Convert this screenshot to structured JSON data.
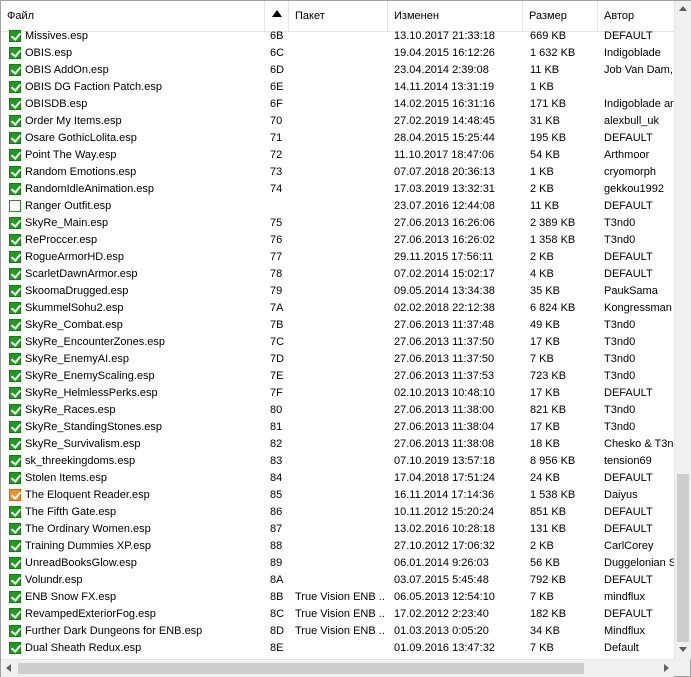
{
  "columns": {
    "file": "Файл",
    "index": "",
    "package": "Пакет",
    "modified": "Изменен",
    "size": "Размер",
    "author": "Автор"
  },
  "rows": [
    {
      "checkbox": "checked",
      "name": "Missives.esp",
      "index": "6B",
      "package": "",
      "modified": "13.10.2017 21:33:18",
      "size": "669 KB",
      "author": "DEFAULT"
    },
    {
      "checkbox": "checked",
      "name": "OBIS.esp",
      "index": "6C",
      "package": "",
      "modified": "19.04.2015 16:12:26",
      "size": "1 632 KB",
      "author": "Indigoblade"
    },
    {
      "checkbox": "checked",
      "name": "OBIS AddOn.esp",
      "index": "6D",
      "package": "",
      "modified": "23.04.2014 2:39:08",
      "size": "11 KB",
      "author": "Job Van Dam,"
    },
    {
      "checkbox": "checked",
      "name": "OBIS DG Faction Patch.esp",
      "index": "6E",
      "package": "",
      "modified": "14.11.2014 13:31:19",
      "size": "1 KB",
      "author": ""
    },
    {
      "checkbox": "checked",
      "name": "OBISDB.esp",
      "index": "6F",
      "package": "",
      "modified": "14.02.2015 16:31:16",
      "size": "171 KB",
      "author": "Indigoblade ar"
    },
    {
      "checkbox": "checked",
      "name": "Order My Items.esp",
      "index": "70",
      "package": "",
      "modified": "27.02.2019 14:48:45",
      "size": "31 KB",
      "author": "alexbull_uk"
    },
    {
      "checkbox": "checked",
      "name": "Osare GothicLolita.esp",
      "index": "71",
      "package": "",
      "modified": "28.04.2015 15:25:44",
      "size": "195 KB",
      "author": "DEFAULT"
    },
    {
      "checkbox": "checked",
      "name": "Point The Way.esp",
      "index": "72",
      "package": "",
      "modified": "11.10.2017 18:47:06",
      "size": "54 KB",
      "author": "Arthmoor"
    },
    {
      "checkbox": "checked",
      "name": "Random Emotions.esp",
      "index": "73",
      "package": "",
      "modified": "07.07.2018 20:36:13",
      "size": "1 KB",
      "author": "cryomorph"
    },
    {
      "checkbox": "checked",
      "name": "RandomIdleAnimation.esp",
      "index": "74",
      "package": "",
      "modified": "17.03.2019 13:32:31",
      "size": "2 KB",
      "author": "gekkou1992"
    },
    {
      "checkbox": "unchecked",
      "name": "Ranger Outfit.esp",
      "index": "",
      "package": "",
      "modified": "23.07.2016 12:44:08",
      "size": "11 KB",
      "author": "DEFAULT"
    },
    {
      "checkbox": "checked",
      "name": "SkyRe_Main.esp",
      "index": "75",
      "package": "",
      "modified": "27.06.2013 16:26:06",
      "size": "2 389 KB",
      "author": "T3nd0"
    },
    {
      "checkbox": "checked",
      "name": "ReProccer.esp",
      "index": "76",
      "package": "",
      "modified": "27.06.2013 16:26:02",
      "size": "1 358 KB",
      "author": "T3nd0"
    },
    {
      "checkbox": "checked",
      "name": "RogueArmorHD.esp",
      "index": "77",
      "package": "",
      "modified": "29.11.2015 17:56:11",
      "size": "2 KB",
      "author": "DEFAULT"
    },
    {
      "checkbox": "checked",
      "name": "ScarletDawnArmor.esp",
      "index": "78",
      "package": "",
      "modified": "07.02.2014 15:02:17",
      "size": "4 KB",
      "author": "DEFAULT"
    },
    {
      "checkbox": "checked",
      "name": "SkoomaDrugged.esp",
      "index": "79",
      "package": "",
      "modified": "09.05.2014 13:34:38",
      "size": "35 KB",
      "author": "PaukSama"
    },
    {
      "checkbox": "checked",
      "name": "SkummelSohu2.esp",
      "index": "7A",
      "package": "",
      "modified": "02.02.2018 22:12:38",
      "size": "6 824 KB",
      "author": "Kongressman"
    },
    {
      "checkbox": "checked",
      "name": "SkyRe_Combat.esp",
      "index": "7B",
      "package": "",
      "modified": "27.06.2013 11:37:48",
      "size": "49 KB",
      "author": "T3nd0"
    },
    {
      "checkbox": "checked",
      "name": "SkyRe_EncounterZones.esp",
      "index": "7C",
      "package": "",
      "modified": "27.06.2013 11:37:50",
      "size": "17 KB",
      "author": "T3nd0"
    },
    {
      "checkbox": "checked",
      "name": "SkyRe_EnemyAI.esp",
      "index": "7D",
      "package": "",
      "modified": "27.06.2013 11:37:50",
      "size": "7 KB",
      "author": "T3nd0"
    },
    {
      "checkbox": "checked",
      "name": "SkyRe_EnemyScaling.esp",
      "index": "7E",
      "package": "",
      "modified": "27.06.2013 11:37:53",
      "size": "723 KB",
      "author": "T3nd0"
    },
    {
      "checkbox": "checked",
      "name": "SkyRe_HelmlessPerks.esp",
      "index": "7F",
      "package": "",
      "modified": "02.10.2013 10:48:10",
      "size": "17 KB",
      "author": "DEFAULT"
    },
    {
      "checkbox": "checked",
      "name": "SkyRe_Races.esp",
      "index": "80",
      "package": "",
      "modified": "27.06.2013 11:38:00",
      "size": "821 KB",
      "author": "T3nd0"
    },
    {
      "checkbox": "checked",
      "name": "SkyRe_StandingStones.esp",
      "index": "81",
      "package": "",
      "modified": "27.06.2013 11:38:04",
      "size": "17 KB",
      "author": "T3nd0"
    },
    {
      "checkbox": "checked",
      "name": "SkyRe_Survivalism.esp",
      "index": "82",
      "package": "",
      "modified": "27.06.2013 11:38:08",
      "size": "18 KB",
      "author": "Chesko & T3nc"
    },
    {
      "checkbox": "checked",
      "name": "sk_threekingdoms.esp",
      "index": "83",
      "package": "",
      "modified": "07.10.2019 13:57:18",
      "size": "8 956 KB",
      "author": "tension69"
    },
    {
      "checkbox": "checked",
      "name": "Stolen Items.esp",
      "index": "84",
      "package": "",
      "modified": "17.04.2018 17:51:24",
      "size": "24 KB",
      "author": "DEFAULT"
    },
    {
      "checkbox": "warning",
      "name": "The Eloquent Reader.esp",
      "index": "85",
      "package": "",
      "modified": "16.11.2014 17:14:36",
      "size": "1 538 KB",
      "author": "Daiyus"
    },
    {
      "checkbox": "checked",
      "name": "The Fifth Gate.esp",
      "index": "86",
      "package": "",
      "modified": "10.11.2012 15:20:24",
      "size": "851 KB",
      "author": "DEFAULT"
    },
    {
      "checkbox": "checked",
      "name": "The Ordinary Women.esp",
      "index": "87",
      "package": "",
      "modified": "13.02.2016 10:28:18",
      "size": "131 KB",
      "author": "DEFAULT"
    },
    {
      "checkbox": "checked",
      "name": "Training Dummies XP.esp",
      "index": "88",
      "package": "",
      "modified": "27.10.2012 17:06:32",
      "size": "2 KB",
      "author": "CarlCorey"
    },
    {
      "checkbox": "checked",
      "name": "UnreadBooksGlow.esp",
      "index": "89",
      "package": "",
      "modified": "06.01.2014 9:26:03",
      "size": "56 KB",
      "author": "Duggelonian S"
    },
    {
      "checkbox": "checked",
      "name": "Volundr.esp",
      "index": "8A",
      "package": "",
      "modified": "03.07.2015 5:45:48",
      "size": "792 KB",
      "author": "DEFAULT"
    },
    {
      "checkbox": "checked",
      "name": "ENB Snow FX.esp",
      "index": "8B",
      "package": "True Vision ENB ...",
      "modified": "06.05.2013 12:54:10",
      "size": "7 KB",
      "author": "mindflux"
    },
    {
      "checkbox": "checked",
      "name": "RevampedExteriorFog.esp",
      "index": "8C",
      "package": "True Vision ENB ...",
      "modified": "17.02.2012 2:23:40",
      "size": "182 KB",
      "author": "DEFAULT"
    },
    {
      "checkbox": "checked",
      "name": "Further Dark Dungeons for ENB.esp",
      "index": "8D",
      "package": "True Vision ENB ...",
      "modified": "01.03.2013 0:05:20",
      "size": "34 KB",
      "author": "Mindflux"
    },
    {
      "checkbox": "checked",
      "name": "Dual Sheath Redux.esp",
      "index": "8E",
      "package": "",
      "modified": "01.09.2016 13:47:32",
      "size": "7 KB",
      "author": "Default"
    }
  ]
}
